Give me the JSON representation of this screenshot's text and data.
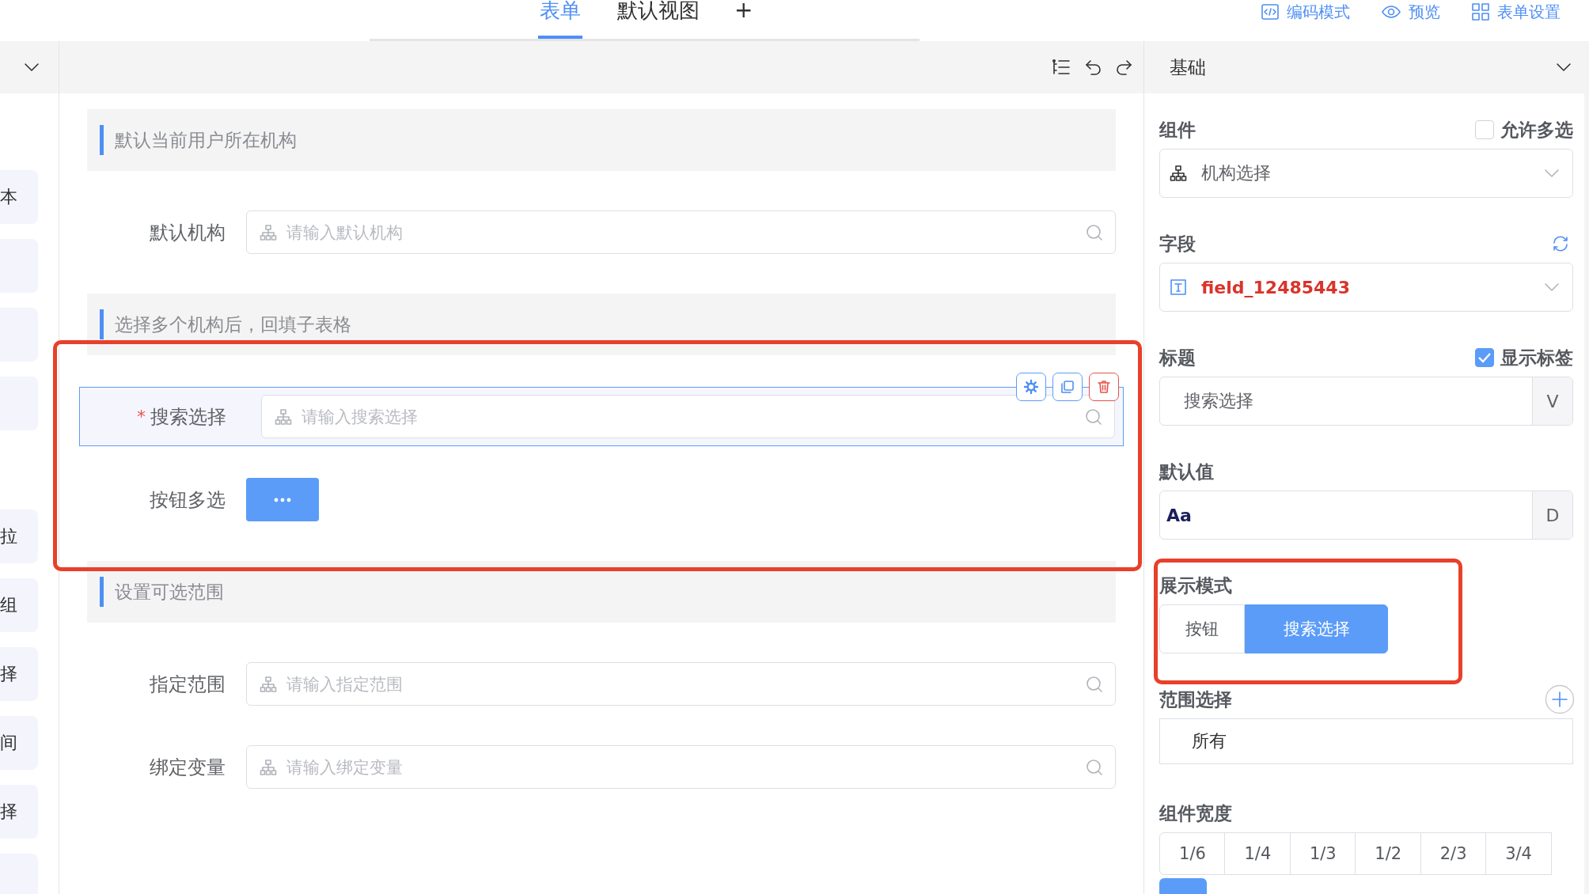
{
  "top_bar": {
    "tabs": [
      {
        "label": "表单",
        "selected": true
      },
      {
        "label": "默认视图",
        "selected": false
      }
    ],
    "add_tab": "+",
    "actions": [
      {
        "kind": "code",
        "label": "编码模式"
      },
      {
        "kind": "preview",
        "label": "预览"
      },
      {
        "kind": "settings",
        "label": "表单设置"
      }
    ]
  },
  "left_panel": {
    "groups": [
      {
        "items": [
          {
            "kind": "text",
            "label": "本"
          },
          {
            "kind": "blank"
          },
          {
            "kind": "blank"
          },
          {
            "kind": "blank"
          }
        ]
      },
      {
        "items": [
          {
            "kind": "text",
            "label": "拉"
          },
          {
            "kind": "text",
            "label": "组"
          },
          {
            "kind": "text",
            "label": "择"
          },
          {
            "kind": "text",
            "label": "间"
          },
          {
            "kind": "text",
            "label": "择"
          },
          {
            "kind": "blank"
          }
        ]
      }
    ]
  },
  "canvas": {
    "sections": [
      {
        "title": "默认当前用户所在机构",
        "highlighted": false,
        "fields": [
          {
            "kind": "input",
            "label": "默认机构",
            "placeholder": "请输入默认机构",
            "selected": false
          }
        ]
      },
      {
        "title": "选择多个机构后，回填子表格",
        "highlighted": true,
        "fields": [
          {
            "kind": "input",
            "label": "搜索选择",
            "required_mark": "*",
            "placeholder": "请输入搜索选择",
            "selected": true
          },
          {
            "kind": "button",
            "label": "按钮多选",
            "selected": false
          }
        ]
      },
      {
        "title": "设置可选范围",
        "highlighted": false,
        "fields": [
          {
            "kind": "input",
            "label": "指定范围",
            "placeholder": "请输入指定范围",
            "selected": false
          },
          {
            "kind": "input",
            "label": "绑定变量",
            "placeholder": "请输入绑定变量",
            "selected": false
          }
        ]
      }
    ]
  },
  "properties": {
    "title": "基础",
    "groups": [
      {
        "kind": "orgselect",
        "label": "组件",
        "option": {
          "label": "允许多选",
          "checked": false
        },
        "value": "机构选择"
      },
      {
        "kind": "fieldselect",
        "label": "字段",
        "value": "field_12485443"
      },
      {
        "kind": "input",
        "label": "标题",
        "option": {
          "label": "显示标签",
          "checked": true
        },
        "value": "搜索选择",
        "addon": "V"
      },
      {
        "kind": "preview",
        "label": "默认值",
        "value": "Aa",
        "addon": "D"
      },
      {
        "kind": "segmented",
        "label": "展示模式",
        "highlighted": true,
        "options": [
          {
            "label": "按钮",
            "selected": false
          },
          {
            "label": "搜索选择",
            "selected": true
          }
        ]
      },
      {
        "kind": "list",
        "label": "范围选择",
        "value": "所有"
      },
      {
        "kind": "widths",
        "label": "组件宽度",
        "options": [
          {
            "label": "1/6",
            "selected": false
          },
          {
            "label": "1/4",
            "selected": false
          },
          {
            "label": "1/3",
            "selected": false
          },
          {
            "label": "1/2",
            "selected": false
          },
          {
            "label": "2/3",
            "selected": false
          },
          {
            "label": "3/4",
            "selected": false
          }
        ],
        "next_row": {
          "selected": true
        }
      }
    ]
  }
}
